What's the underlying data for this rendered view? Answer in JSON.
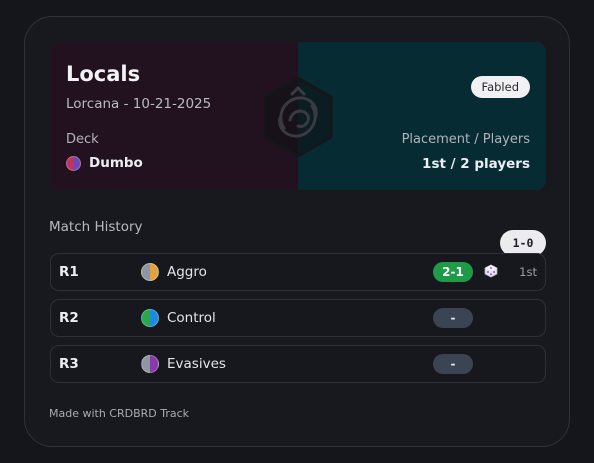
{
  "event": {
    "title": "Locals",
    "subtitle": "Lorcana - 10-21-2025",
    "badge": "Fabled",
    "deck_label": "Deck",
    "deck_name": "Dumbo",
    "deck_colors": [
      "#c2345e",
      "#6b4bb3"
    ],
    "placement_label": "Placement / Players",
    "placement_value": "1st / 2 players"
  },
  "match_history": {
    "title": "Match History",
    "record": "1-0",
    "matches": [
      {
        "round": "R1",
        "opponent": "Aggro",
        "colors": [
          "#8e95a3",
          "#e3a23b"
        ],
        "score": "2-1",
        "result": "win",
        "icon": "die-icon",
        "placing": "1st"
      },
      {
        "round": "R2",
        "opponent": "Control",
        "colors": [
          "#28a84a",
          "#1e88e5"
        ],
        "score": "-",
        "result": "none"
      },
      {
        "round": "R3",
        "opponent": "Evasives",
        "colors": [
          "#8e95a3",
          "#8a3aa8"
        ],
        "score": "-",
        "result": "none"
      }
    ]
  },
  "footer": "Made with CRDBRD Track",
  "colors": {
    "win": "#1f9a47",
    "pending": "#3a4452",
    "banner_left": "#221220",
    "banner_right": "#062b33"
  }
}
